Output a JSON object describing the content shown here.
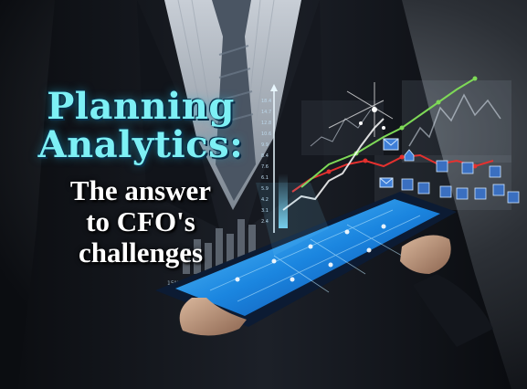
{
  "headline": {
    "title_line1": "Planning",
    "title_line2": "Analytics:",
    "subtitle_line1": "The answer",
    "subtitle_line2": "to CFO's",
    "subtitle_line3": "challenges"
  },
  "decor": {
    "percent_label": "15%",
    "axis_labels": [
      "18.4",
      "14.7",
      "12.8",
      "10.6",
      "9.9",
      "8.4",
      "7.6",
      "6.1",
      "5.9",
      "4.2",
      "3.1",
      "2.4"
    ]
  },
  "colors": {
    "title": "#7df0f5",
    "subtitle": "#ffffff",
    "tablet_glow": "#2aa3f0",
    "trend_red": "#e4312f",
    "trend_green": "#7ed957"
  }
}
